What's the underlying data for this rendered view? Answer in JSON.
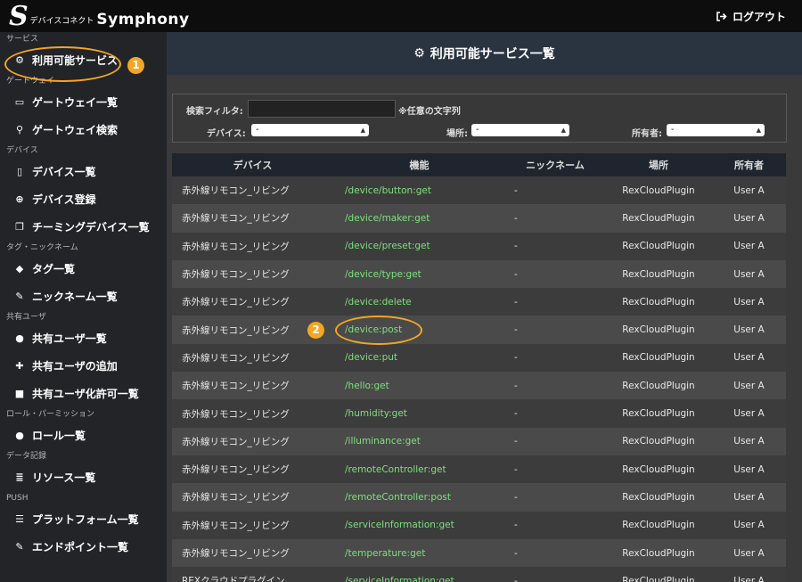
{
  "app": {
    "logo_s": "S",
    "logo_sub": "デバイスコネクト",
    "logo_main": "Symphony",
    "logout": "ログアウト"
  },
  "sidebar": {
    "sections": [
      {
        "title": "サービス",
        "items": [
          {
            "label": "利用可能サービス",
            "icon": "gears-icon",
            "glyph": "⚙"
          }
        ]
      },
      {
        "title": "ゲートウェイ",
        "items": [
          {
            "label": "ゲートウェイ一覧",
            "icon": "hdd-icon",
            "glyph": "▭"
          },
          {
            "label": "ゲートウェイ検索",
            "icon": "search-icon",
            "glyph": "⚲"
          }
        ]
      },
      {
        "title": "デバイス",
        "items": [
          {
            "label": "デバイス一覧",
            "icon": "mobile-icon",
            "glyph": "▯"
          },
          {
            "label": "デバイス登録",
            "icon": "plus-circle-icon",
            "glyph": "⊕"
          },
          {
            "label": "チーミングデバイス一覧",
            "icon": "clone-icon",
            "glyph": "❐"
          }
        ]
      },
      {
        "title": "タグ・ニックネーム",
        "items": [
          {
            "label": "タグ一覧",
            "icon": "tags-icon",
            "glyph": "◆"
          },
          {
            "label": "ニックネーム一覧",
            "icon": "pencil-icon",
            "glyph": "✎"
          }
        ]
      },
      {
        "title": "共有ユーザ",
        "items": [
          {
            "label": "共有ユーザ一覧",
            "icon": "user-icon",
            "glyph": "●"
          },
          {
            "label": "共有ユーザの追加",
            "icon": "user-plus-icon",
            "glyph": "✚"
          },
          {
            "label": "共有ユーザ化許可一覧",
            "icon": "unlock-icon",
            "glyph": "■"
          }
        ]
      },
      {
        "title": "ロール・パーミッション",
        "items": [
          {
            "label": "ロール一覧",
            "icon": "users-icon",
            "glyph": "●"
          }
        ]
      },
      {
        "title": "データ記録",
        "items": [
          {
            "label": "リソース一覧",
            "icon": "database-icon",
            "glyph": "≣"
          }
        ]
      },
      {
        "title": "PUSH",
        "items": [
          {
            "label": "プラットフォーム一覧",
            "icon": "server-icon",
            "glyph": "☰"
          },
          {
            "label": "エンドポイント一覧",
            "icon": "edit-icon",
            "glyph": "✎"
          }
        ]
      }
    ]
  },
  "header": {
    "title": "利用可能サービス一覧"
  },
  "filter": {
    "search_label": "検索フィルタ:",
    "search_value": "",
    "note": "※任意の文字列",
    "device_label": "デバイス:",
    "device_value": "-",
    "place_label": "場所:",
    "place_value": "-",
    "owner_label": "所有者:",
    "owner_value": "-"
  },
  "table": {
    "headers": [
      "デバイス",
      "機能",
      "ニックネーム",
      "場所",
      "所有者"
    ],
    "rows": [
      [
        "赤外線リモコン_リビング",
        "/device/button:get",
        "-",
        "RexCloudPlugin",
        "User A"
      ],
      [
        "赤外線リモコン_リビング",
        "/device/maker:get",
        "-",
        "RexCloudPlugin",
        "User A"
      ],
      [
        "赤外線リモコン_リビング",
        "/device/preset:get",
        "-",
        "RexCloudPlugin",
        "User A"
      ],
      [
        "赤外線リモコン_リビング",
        "/device/type:get",
        "-",
        "RexCloudPlugin",
        "User A"
      ],
      [
        "赤外線リモコン_リビング",
        "/device:delete",
        "-",
        "RexCloudPlugin",
        "User A"
      ],
      [
        "赤外線リモコン_リビング",
        "/device:post",
        "-",
        "RexCloudPlugin",
        "User A"
      ],
      [
        "赤外線リモコン_リビング",
        "/device:put",
        "-",
        "RexCloudPlugin",
        "User A"
      ],
      [
        "赤外線リモコン_リビング",
        "/hello:get",
        "-",
        "RexCloudPlugin",
        "User A"
      ],
      [
        "赤外線リモコン_リビング",
        "/humidity:get",
        "-",
        "RexCloudPlugin",
        "User A"
      ],
      [
        "赤外線リモコン_リビング",
        "/illuminance:get",
        "-",
        "RexCloudPlugin",
        "User A"
      ],
      [
        "赤外線リモコン_リビング",
        "/remoteController:get",
        "-",
        "RexCloudPlugin",
        "User A"
      ],
      [
        "赤外線リモコン_リビング",
        "/remoteController:post",
        "-",
        "RexCloudPlugin",
        "User A"
      ],
      [
        "赤外線リモコン_リビング",
        "/serviceInformation:get",
        "-",
        "RexCloudPlugin",
        "User A"
      ],
      [
        "赤外線リモコン_リビング",
        "/temperature:get",
        "-",
        "RexCloudPlugin",
        "User A"
      ],
      [
        "REXクラウドプラグイン",
        "/serviceInformation:get",
        "-",
        "RexCloudPlugin",
        "User A"
      ]
    ]
  },
  "annotations": {
    "marker_1": "1",
    "marker_2": "2",
    "color": "#f5a623"
  }
}
